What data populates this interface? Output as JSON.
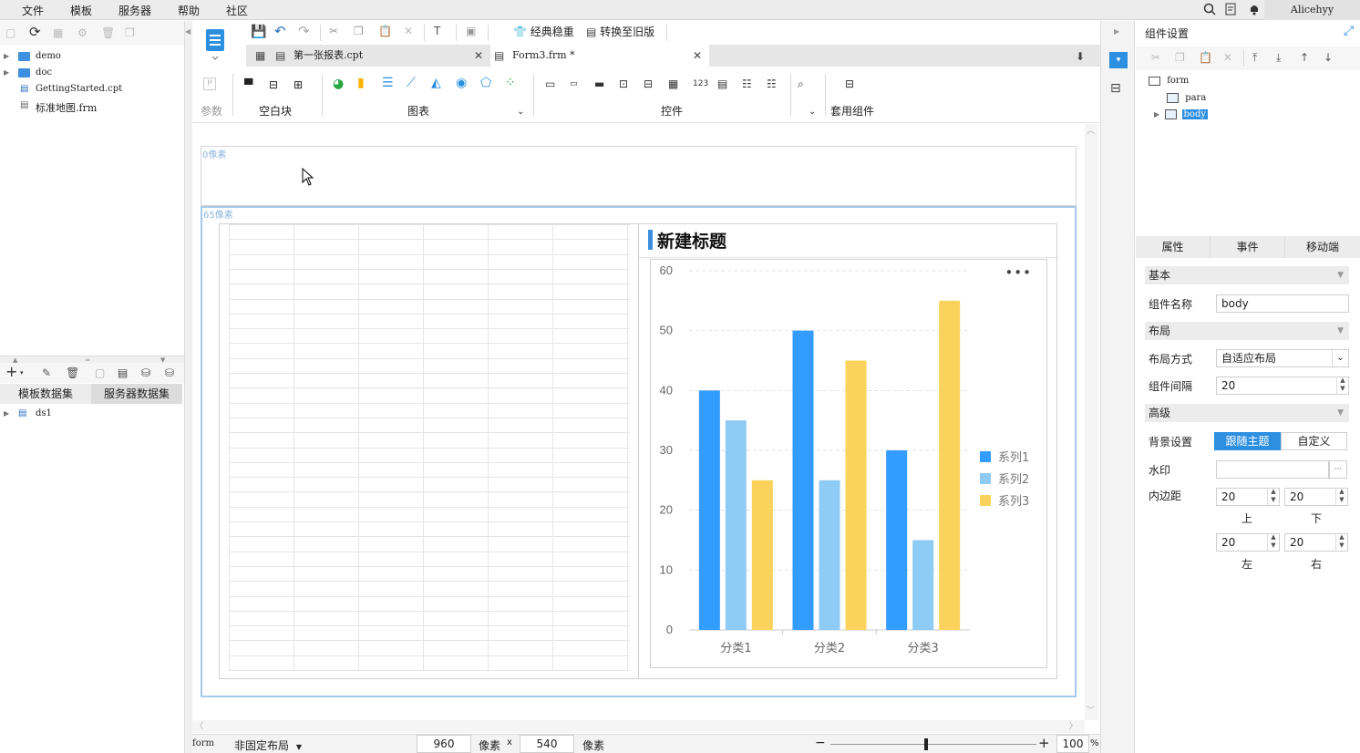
{
  "menu": [
    "文件",
    "模板",
    "服务器",
    "帮助",
    "社区"
  ],
  "user": "Alicehyy",
  "left_tree": [
    {
      "label": "demo",
      "type": "folder"
    },
    {
      "label": "doc",
      "type": "folder"
    },
    {
      "label": "GettingStarted.cpt",
      "type": "file"
    },
    {
      "label": "标准地图.frm",
      "type": "file"
    }
  ],
  "dataset_tabs": [
    "模板数据集",
    "服务器数据集"
  ],
  "datasets": [
    "ds1"
  ],
  "toolbar": {
    "classic": "经典稳重",
    "convert": "转换至旧版"
  },
  "tabs": [
    {
      "label": "第一张报表.cpt",
      "active": false
    },
    {
      "label": "Form3.frm *",
      "active": true
    }
  ],
  "widget_groups": {
    "param": "参数",
    "blank": "空白块",
    "chart": "图表",
    "control": "控件",
    "reuse": "套用组件"
  },
  "canvas": {
    "top_px_label": "0像素",
    "body_px_label": "65像素"
  },
  "chart_data": {
    "type": "bar",
    "title": "新建标题",
    "categories": [
      "分类1",
      "分类2",
      "分类3"
    ],
    "series": [
      {
        "name": "系列1",
        "values": [
          40,
          50,
          30
        ],
        "color": "#339cff"
      },
      {
        "name": "系列2",
        "values": [
          35,
          25,
          15
        ],
        "color": "#8ecbf5"
      },
      {
        "name": "系列3",
        "values": [
          25,
          45,
          55
        ],
        "color": "#fbd35c"
      }
    ],
    "ylim": [
      0,
      60
    ],
    "yticks": [
      0,
      10,
      20,
      30,
      40,
      50,
      60
    ],
    "grid": true,
    "legend": "right"
  },
  "status": {
    "form_label": "form",
    "layout": "非固定布局",
    "width": "960",
    "unit1": "像素",
    "times": "x",
    "height": "540",
    "unit2": "像素",
    "zoom": "100",
    "percent": "%"
  },
  "right_panel": {
    "title": "组件设置",
    "tree": {
      "root": "form",
      "children": [
        "para",
        "body"
      ]
    },
    "tabs": [
      "属性",
      "事件",
      "移动端"
    ],
    "sections": {
      "basic": "基本",
      "layout": "布局",
      "advanced": "高级"
    },
    "fields": {
      "name_label": "组件名称",
      "name_value": "body",
      "layout_label": "布局方式",
      "layout_value": "自适应布局",
      "gap_label": "组件间隔",
      "gap_value": "20",
      "bg_label": "背景设置",
      "bg_opt1": "跟随主题",
      "bg_opt2": "自定义",
      "watermark_label": "水印",
      "watermark_btn": "···",
      "padding_label": "内边距",
      "pad_top": "20",
      "pad_bottom": "20",
      "pad_left": "20",
      "pad_right": "20",
      "top": "上",
      "bottom": "下",
      "left": "左",
      "right": "右"
    }
  }
}
